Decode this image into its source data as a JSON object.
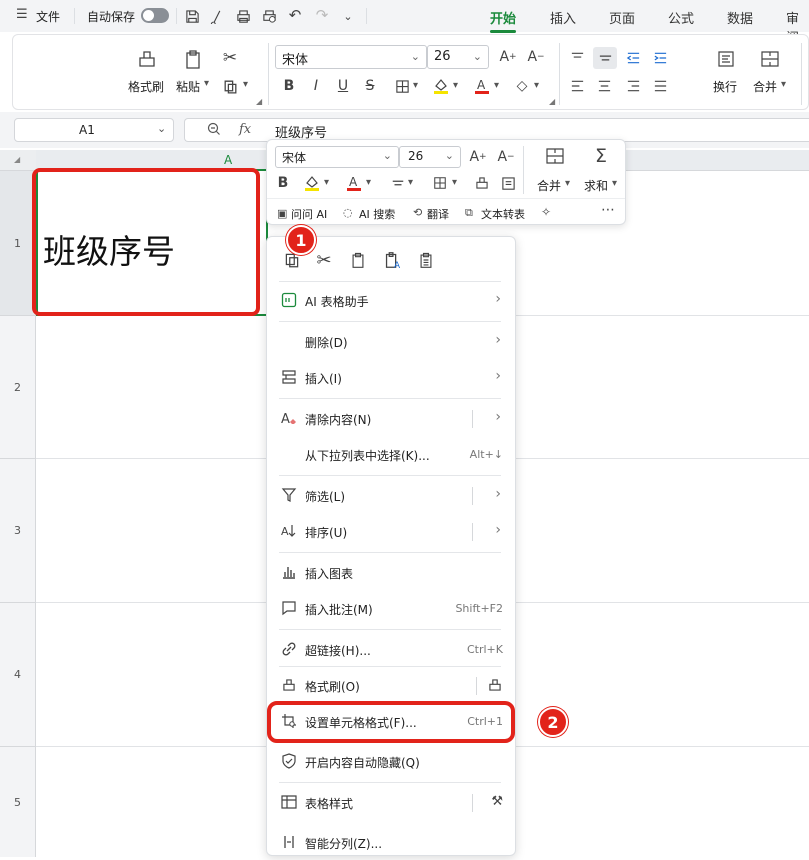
{
  "topbar": {
    "file_label": "文件",
    "autosave_label": "自动保存",
    "tabs": [
      "开始",
      "插入",
      "页面",
      "公式",
      "数据",
      "审阅"
    ],
    "active_tab": "开始"
  },
  "ribbon": {
    "format_painter": "格式刷",
    "paste": "粘贴",
    "font_name": "宋体",
    "font_size": "26",
    "bold": "B",
    "italic": "I",
    "underline": "U",
    "strike": "S",
    "wrap": "换行",
    "merge": "合并"
  },
  "formula_bar": {
    "cell_ref": "A1",
    "fx": "fx",
    "content": "班级序号"
  },
  "grid": {
    "column_a": "A",
    "rows": [
      "1",
      "2",
      "3",
      "4",
      "5"
    ],
    "cell_a1": "班级序号"
  },
  "float_toolbar": {
    "font_name": "宋体",
    "font_size": "26",
    "bold": "B",
    "merge": "合并",
    "sum": "求和",
    "ask_ai": "问问 AI",
    "ai_search": "AI 搜索",
    "translate": "翻译",
    "text_to_table": "文本转表"
  },
  "context_menu": {
    "items": [
      {
        "label": "AI 表格助手",
        "shortcut": ""
      },
      {
        "label": "删除(D)",
        "shortcut": ""
      },
      {
        "label": "插入(I)",
        "shortcut": ""
      },
      {
        "label": "清除内容(N)",
        "shortcut": ""
      },
      {
        "label": "从下拉列表中选择(K)...",
        "shortcut": "Alt+↓"
      },
      {
        "label": "筛选(L)",
        "shortcut": ""
      },
      {
        "label": "排序(U)",
        "shortcut": ""
      },
      {
        "label": "插入图表",
        "shortcut": ""
      },
      {
        "label": "插入批注(M)",
        "shortcut": "Shift+F2"
      },
      {
        "label": "超链接(H)...",
        "shortcut": "Ctrl+K"
      },
      {
        "label": "格式刷(O)",
        "shortcut": ""
      },
      {
        "label": "设置单元格格式(F)...",
        "shortcut": "Ctrl+1"
      },
      {
        "label": "开启内容自动隐藏(Q)",
        "shortcut": ""
      },
      {
        "label": "表格样式",
        "shortcut": ""
      },
      {
        "label": "智能分列(Z)...",
        "shortcut": ""
      }
    ]
  },
  "annotations": {
    "badge1": "1",
    "badge2": "2"
  },
  "colors": {
    "accent": "#1b8a3c",
    "highlight": "#e2231a"
  }
}
